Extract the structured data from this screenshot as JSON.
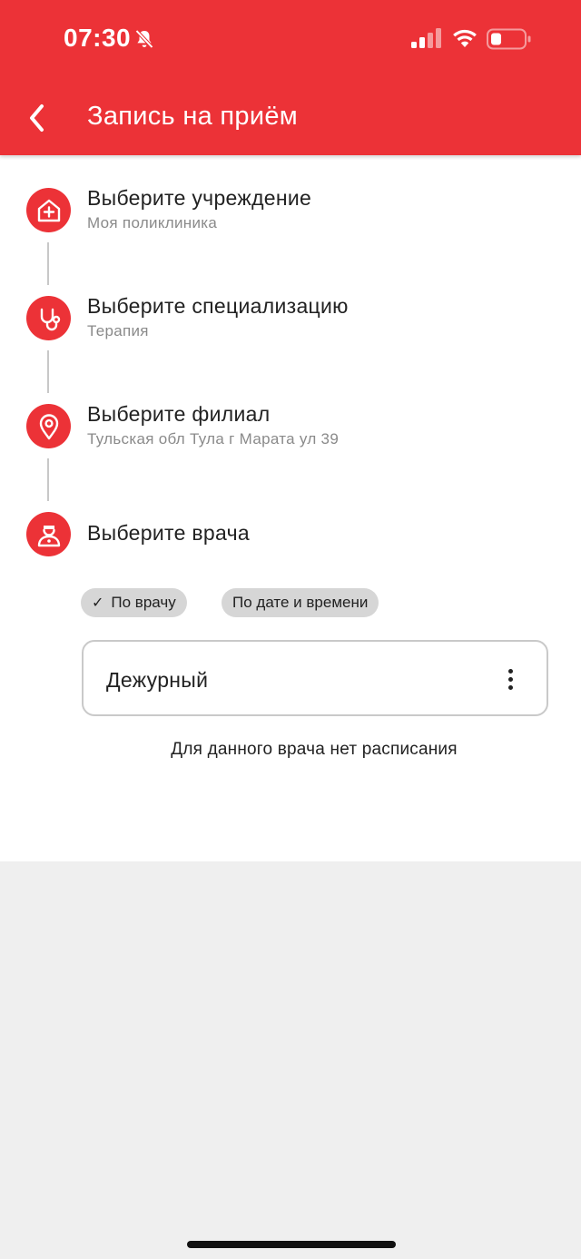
{
  "status_bar": {
    "time": "07:30",
    "icons": [
      "bell-slash-icon",
      "signal-icon",
      "wifi-icon",
      "battery-low-icon"
    ]
  },
  "header": {
    "title": "Запись на приём",
    "back_icon": "chevron-left-icon"
  },
  "steps": [
    {
      "title": "Выберите учреждение",
      "value": "Моя поликлиника",
      "icon": "hospital-icon"
    },
    {
      "title": "Выберите специализацию",
      "value": "Терапия",
      "icon": "stethoscope-icon"
    },
    {
      "title": "Выберите филиал",
      "value": "Тульская обл Тула г Марата ул 39",
      "icon": "location-pin-icon"
    },
    {
      "title": "Выберите врача",
      "value": "",
      "icon": "doctor-icon"
    }
  ],
  "filters": {
    "by_doctor": "По врачу",
    "by_datetime": "По дате и времени",
    "selected": "by_doctor"
  },
  "doctor_card": {
    "name": "Дежурный",
    "menu_icon": "more-vertical-icon"
  },
  "message": "Для данного врача нет расписания",
  "colors": {
    "accent": "#ec3237",
    "chip_bg": "#d6d6d6",
    "page_bg": "#efefef"
  }
}
